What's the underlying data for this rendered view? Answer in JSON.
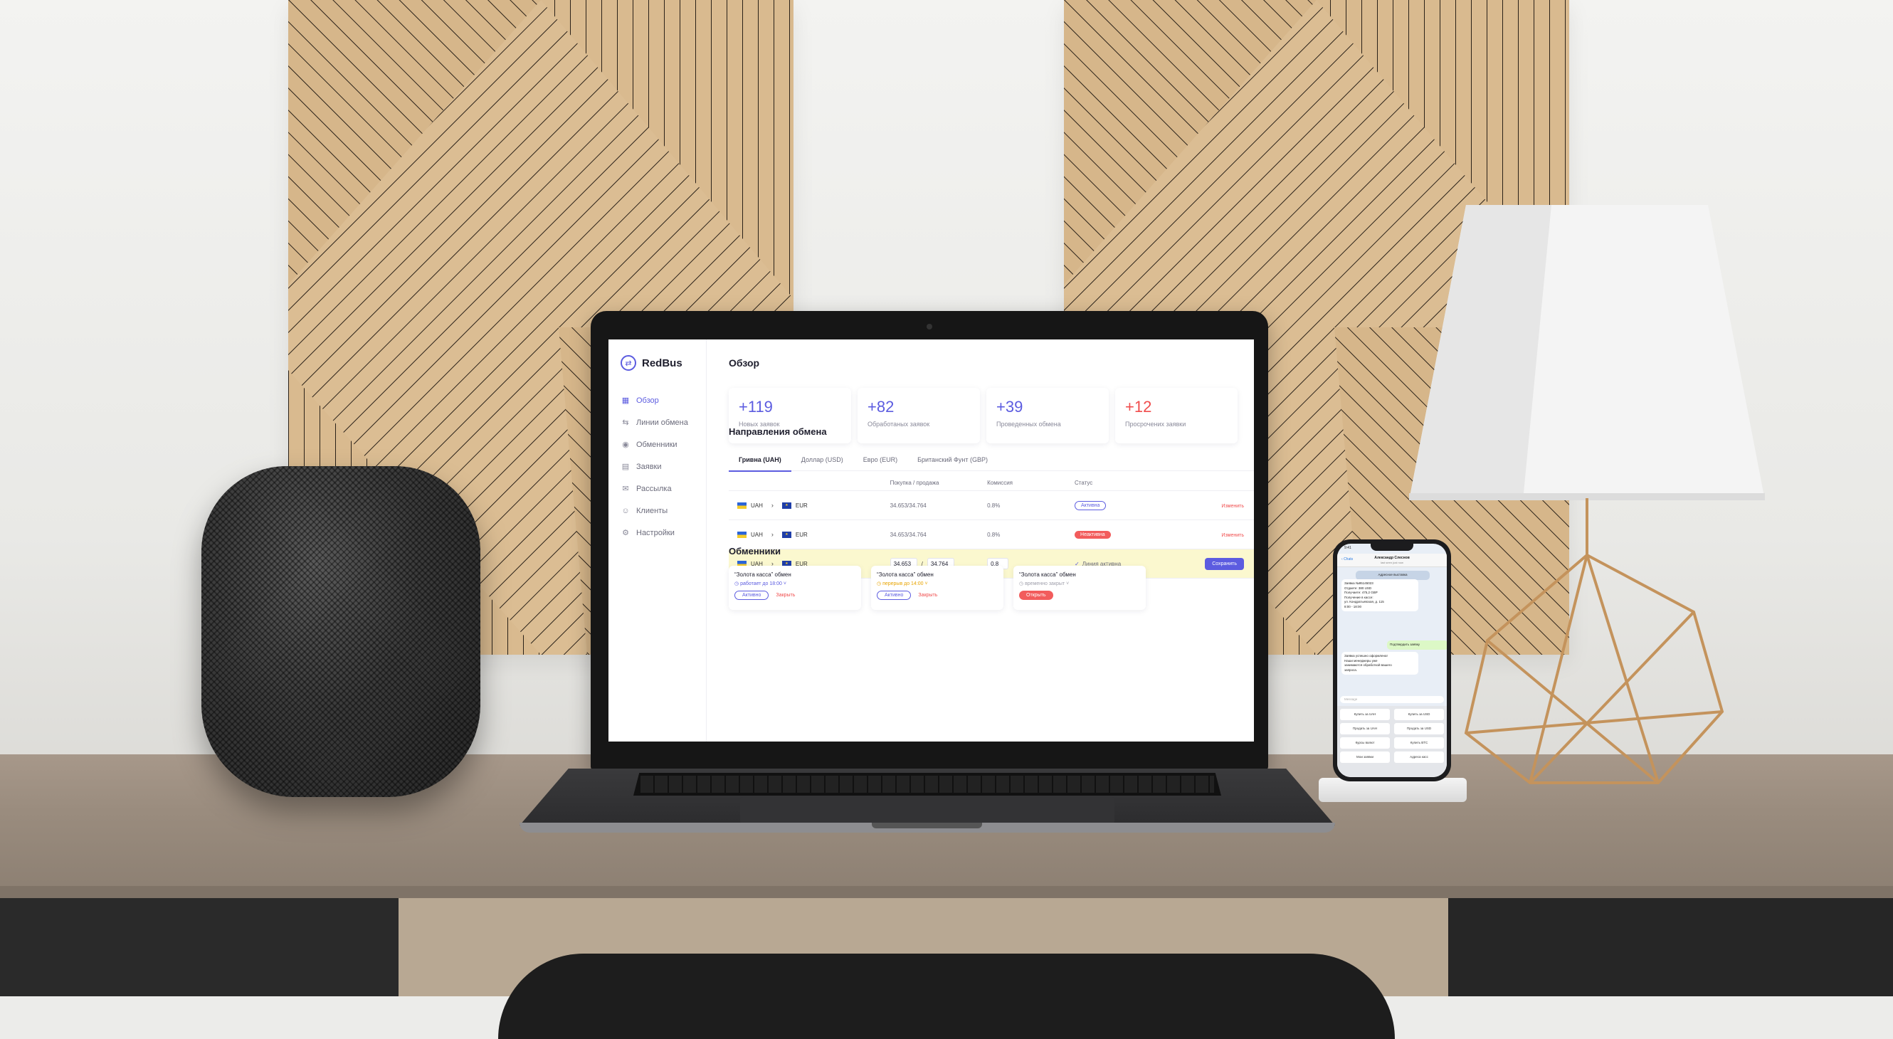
{
  "app": {
    "logo": "RedBus",
    "logo_icon": "swap-arrows-icon",
    "page_title": "Обзор",
    "nav": [
      {
        "label": "Обзор",
        "icon": "grid-icon",
        "active": true
      },
      {
        "label": "Линии обмена",
        "icon": "arrows-icon",
        "active": false
      },
      {
        "label": "Обменники",
        "icon": "location-pin-icon",
        "active": false
      },
      {
        "label": "Заявки",
        "icon": "table-icon",
        "active": false
      },
      {
        "label": "Рассылка",
        "icon": "mail-icon",
        "active": false
      },
      {
        "label": "Клиенты",
        "icon": "users-icon",
        "active": false
      },
      {
        "label": "Настройки",
        "icon": "gear-icon",
        "active": false
      }
    ],
    "stats": [
      {
        "value": "+119",
        "label": "Новых заявок",
        "color": "#5c5ce0"
      },
      {
        "value": "+82",
        "label": "Обработаных заявок",
        "color": "#5c5ce0"
      },
      {
        "value": "+39",
        "label": "Проведенных обмена",
        "color": "#5c5ce0"
      },
      {
        "value": "+12",
        "label": "Просрочених заявки",
        "color": "#f04d4d"
      }
    ],
    "directions_title": "Направления обмена",
    "tabs": [
      "Гривна (UAH)",
      "Доллар (USD)",
      "Евро (EUR)",
      "Британский Фунт (GBP)"
    ],
    "table": {
      "headers": [
        "",
        "Покупка / продажа",
        "Комиссия",
        "Статус",
        ""
      ],
      "rows": [
        {
          "from": "UAH",
          "to": "EUR",
          "rate": "34.653/34.764",
          "fee": "0.8%",
          "status": "Активна",
          "action": "Изменить"
        },
        {
          "from": "UAH",
          "to": "EUR",
          "rate": "34.653/34.764",
          "fee": "0.8%",
          "status": "Неактивна",
          "action": "Изменить"
        },
        {
          "from": "UAH",
          "to": "EUR",
          "buy": "34.653",
          "sell": "34.764",
          "fee": "0.8",
          "status": "Линия активна",
          "action": "Сохранить"
        }
      ]
    },
    "exchangers_title": "Обменники",
    "exchangers": [
      {
        "name": "“Золота касса” обмен",
        "hours": "работает до 18:00",
        "btn": "Активно",
        "link": "Закрыть"
      },
      {
        "name": "“Золота касса” обмен",
        "hours": "перерыв до 14:00",
        "btn": "Активно",
        "link": "Закрыть"
      },
      {
        "name": "“Золота касса” обмен",
        "hours": "временно закрыт",
        "btn": "Открыть",
        "link": ""
      }
    ],
    "colors": {
      "accent": "#5c5ce0",
      "danger": "#f04d4d",
      "highlight_row": "#fbf8cf"
    }
  },
  "phone": {
    "time": "9:41",
    "back": "Chats",
    "contact": "Александр Слеснов",
    "contact_status": "last seen just now",
    "system_note": "Адресное выставка",
    "order_lines": [
      "Заявка №95145023",
      "Отдаете: 380 USD",
      "Получаете: 475,2 GBP",
      "Получение в кассе:",
      "ул. Кондратьевская, д. 115",
      "8:00 - 18:00"
    ],
    "confirm_msg": "Подтвердить заявку",
    "success_lines": [
      "Заявка успешно оформлена!",
      "Наши менеджеры уже",
      "занимаются обработкой вашего",
      "запроса."
    ],
    "input_placeholder": "Message",
    "buttons": [
      "Купить за UAH",
      "Купить за USD",
      "Продать за UAH",
      "Продать за USD",
      "Курсы валют",
      "Купить BTC",
      "Мои заявки",
      "Адреса касс"
    ]
  }
}
